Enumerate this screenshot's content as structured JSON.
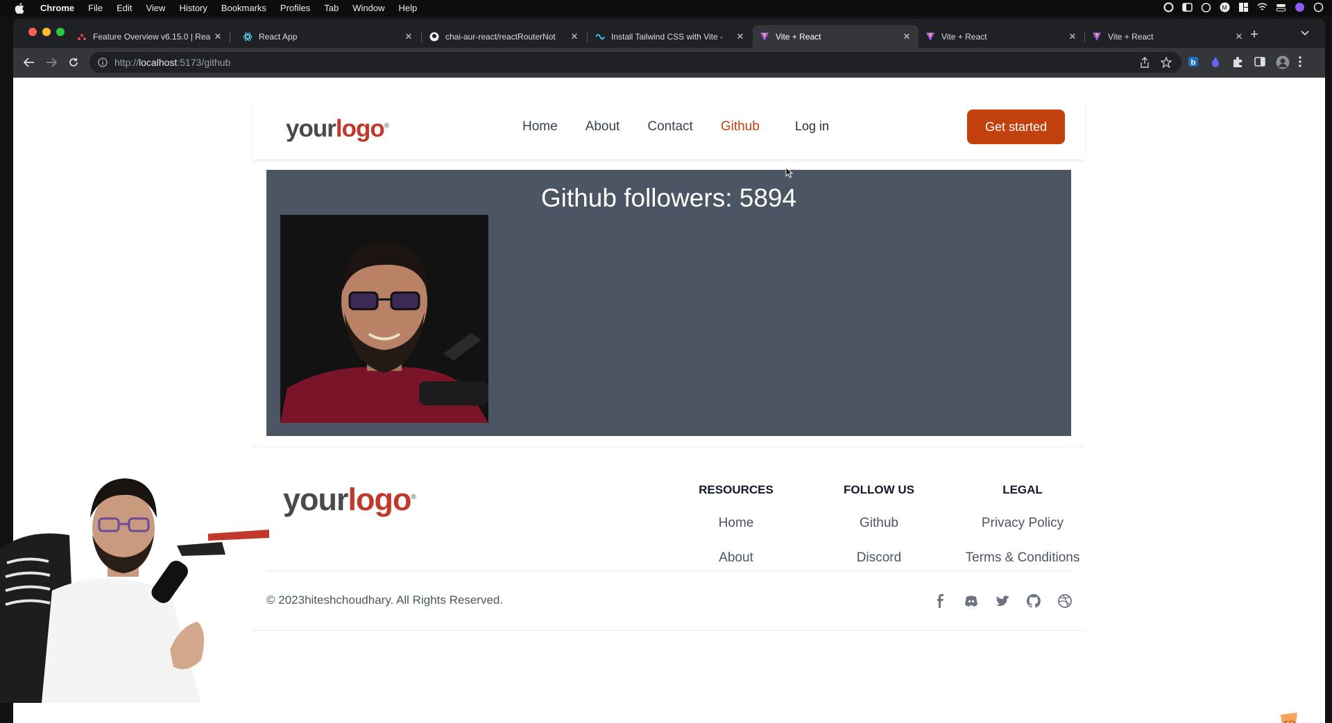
{
  "menubar": {
    "app": "Chrome",
    "items": [
      "File",
      "Edit",
      "View",
      "History",
      "Bookmarks",
      "Profiles",
      "Tab",
      "Window",
      "Help"
    ]
  },
  "tabs": [
    {
      "title": "Feature Overview v6.15.0 | Rea",
      "active": false
    },
    {
      "title": "React App",
      "active": false
    },
    {
      "title": "chai-aur-react/reactRouterNot",
      "active": false
    },
    {
      "title": "Install Tailwind CSS with Vite -",
      "active": false
    },
    {
      "title": "Vite + React",
      "active": true
    },
    {
      "title": "Vite + React",
      "active": false
    },
    {
      "title": "Vite + React",
      "active": false
    }
  ],
  "address": {
    "prefix": "http://",
    "host": "localhost",
    "rest": ":5173/github"
  },
  "header": {
    "logo_your": "your",
    "logo_logo": "logo",
    "logo_reg": "®",
    "nav": [
      "Home",
      "About",
      "Contact",
      "Github"
    ],
    "active_nav": "Github",
    "login": "Log in",
    "cta": "Get started"
  },
  "github": {
    "followers_label": "Github followers: 5894"
  },
  "footer": {
    "logo_your": "your",
    "logo_logo": "logo",
    "logo_reg": "®",
    "resources": {
      "heading": "RESOURCES",
      "items": [
        "Home",
        "About"
      ]
    },
    "follow": {
      "heading": "FOLLOW US",
      "items": [
        "Github",
        "Discord"
      ]
    },
    "legal": {
      "heading": "LEGAL",
      "items": [
        "Privacy Policy",
        "Terms & Conditions"
      ]
    },
    "copyright": "© 2023hiteshchoudhary. All Rights Reserved.",
    "social_icons": [
      "facebook-icon",
      "discord-icon",
      "twitter-icon",
      "github-icon",
      "dribbble-icon"
    ]
  },
  "colors": {
    "accent": "#c2410c",
    "panel": "#4b5563",
    "logo_red": "#c0392b"
  }
}
